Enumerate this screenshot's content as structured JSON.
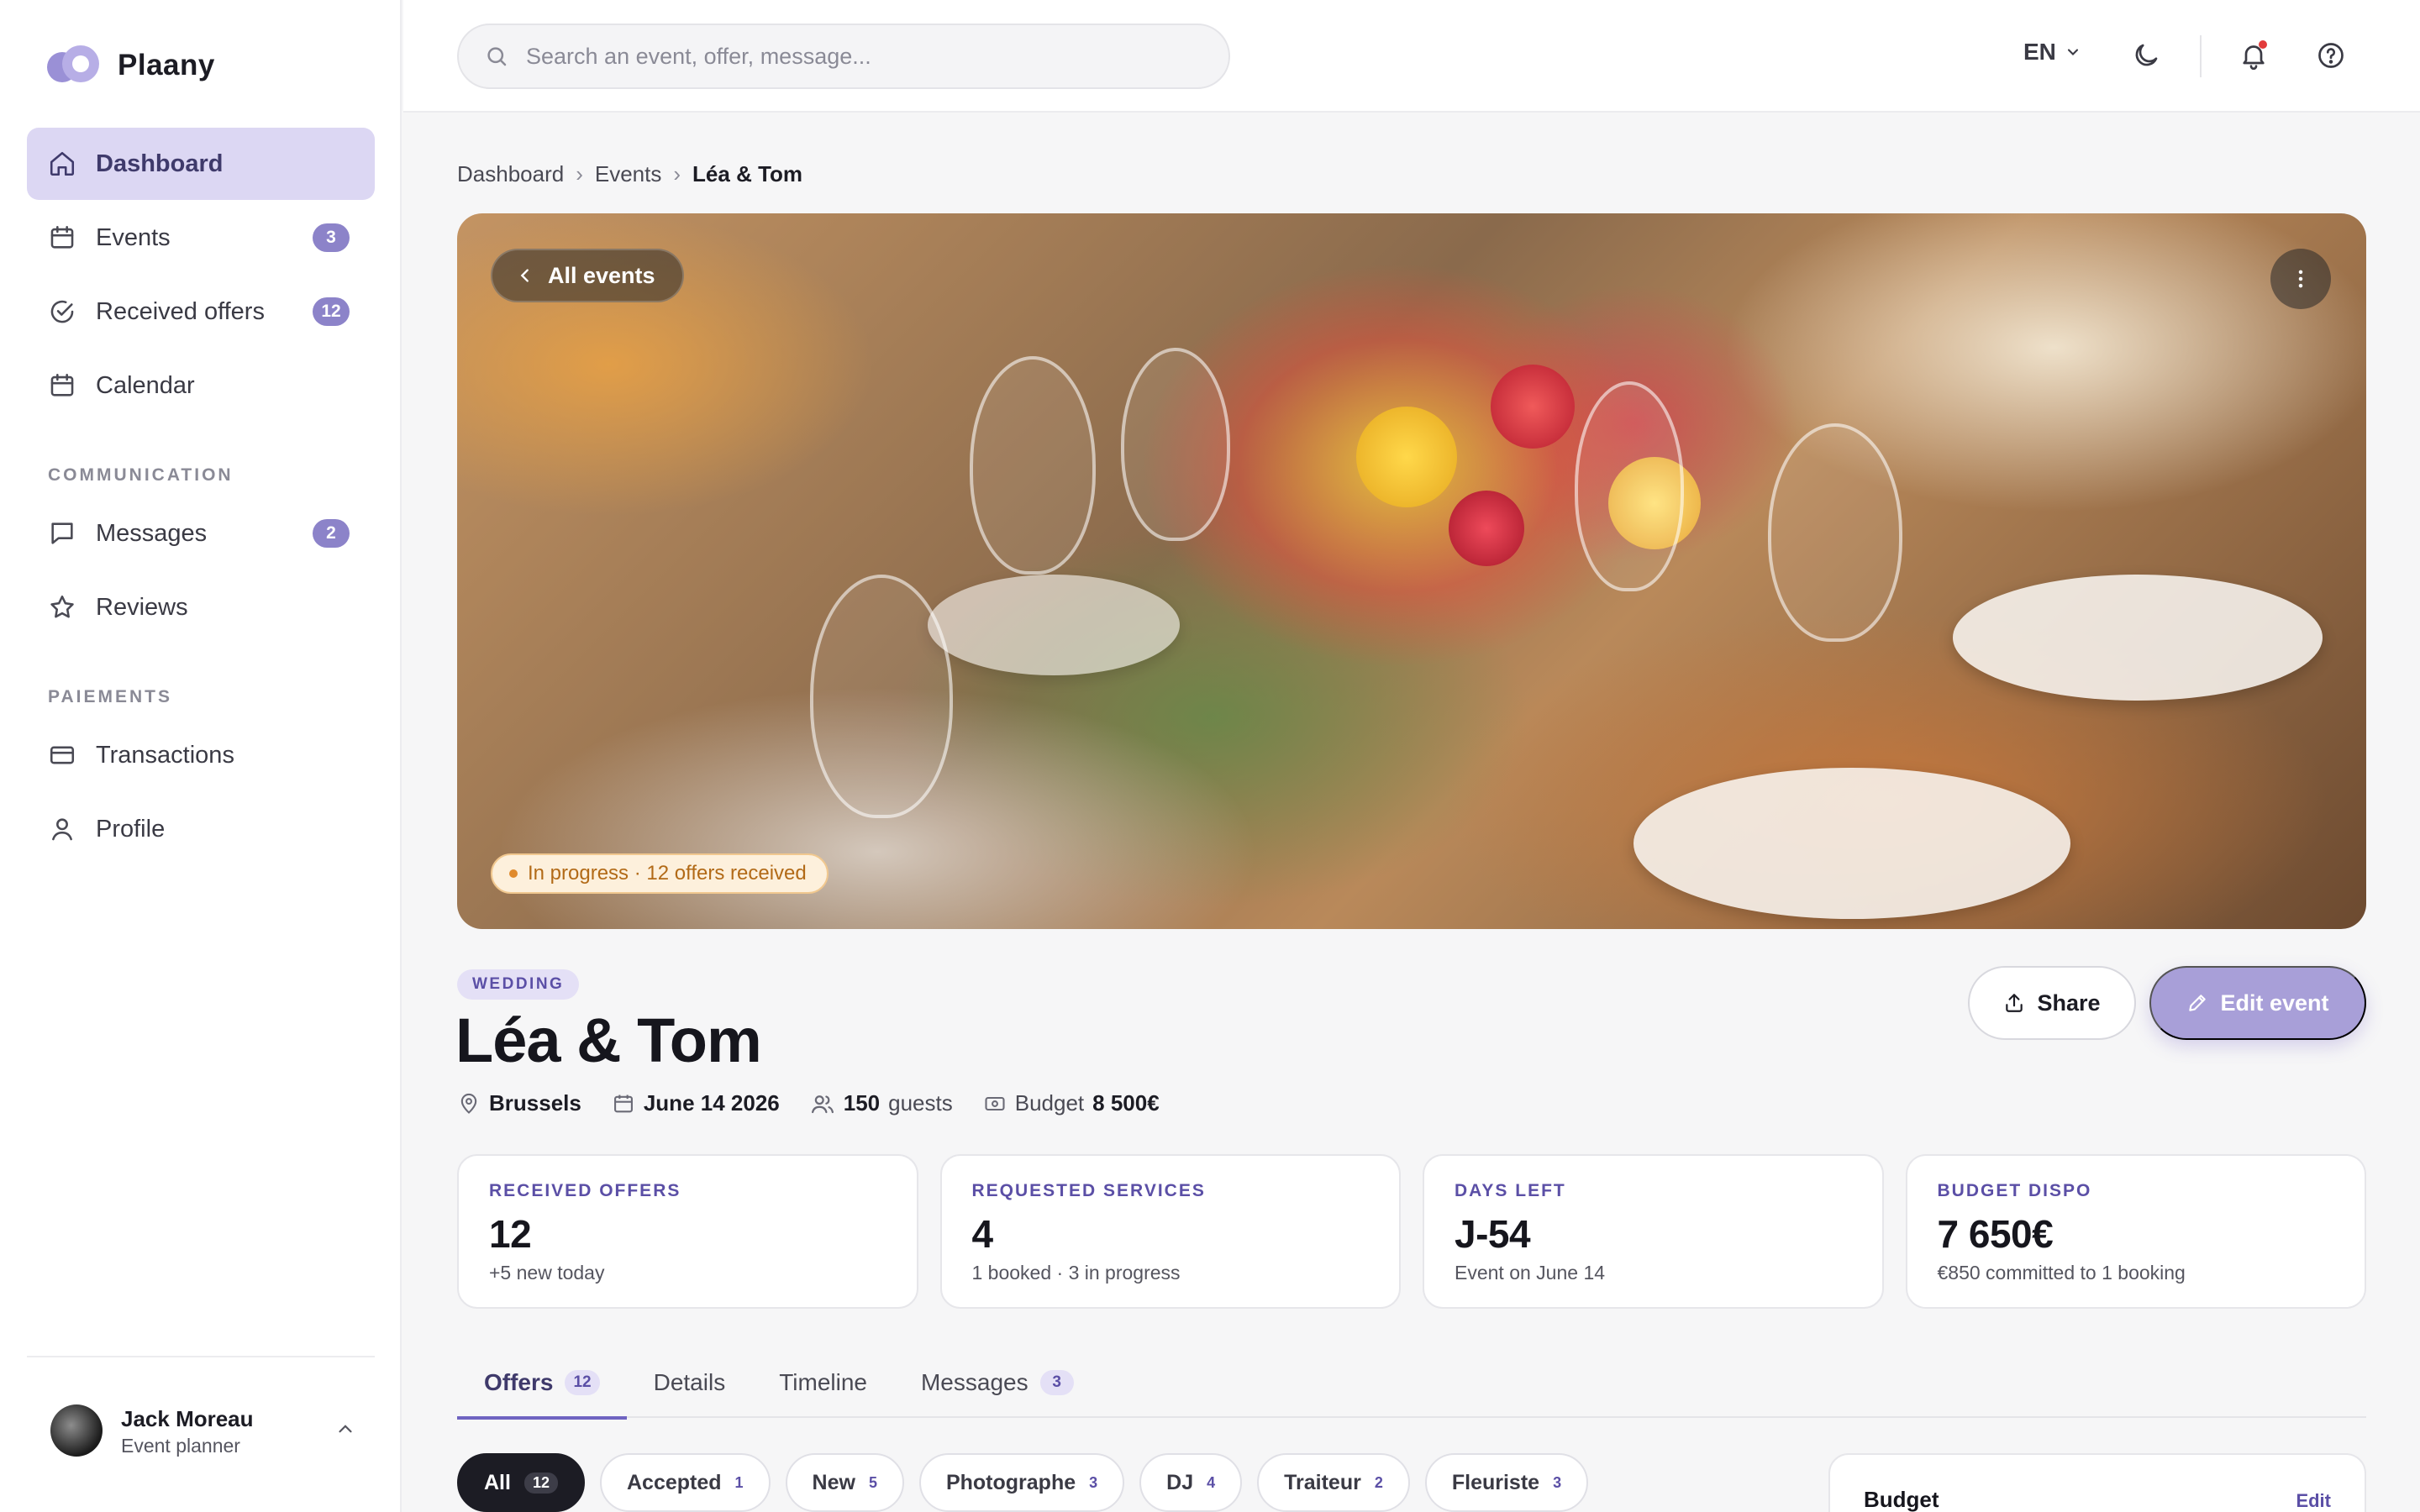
{
  "app": {
    "name": "Plaany"
  },
  "sidebar": {
    "nav": [
      {
        "label": "Dashboard",
        "icon": "home-icon",
        "active": true
      },
      {
        "label": "Events",
        "icon": "calendar-icon",
        "badge": "3"
      },
      {
        "label": "Received offers",
        "icon": "check-circle-icon",
        "badge": "12"
      },
      {
        "label": "Calendar",
        "icon": "calendar-icon"
      }
    ],
    "communication_label": "COMMUNICATION",
    "communication": [
      {
        "label": "Messages",
        "icon": "message-icon",
        "badge": "2"
      },
      {
        "label": "Reviews",
        "icon": "star-icon"
      }
    ],
    "payments_label": "PAIEMENTS",
    "payments": [
      {
        "label": "Transactions",
        "icon": "credit-card-icon"
      },
      {
        "label": "Profile",
        "icon": "user-icon"
      }
    ],
    "user": {
      "name": "Jack Moreau",
      "role": "Event planner"
    }
  },
  "topbar": {
    "search_placeholder": "Search an event, offer, message...",
    "language": "EN"
  },
  "breadcrumb": [
    "Dashboard",
    "Events",
    "Léa & Tom"
  ],
  "hero": {
    "back_label": "All events",
    "status": "In progress · 12 offers received"
  },
  "event": {
    "category": "WEDDING",
    "title": "Léa & Tom",
    "location": "Brussels",
    "date": "June 14 2026",
    "guests_count": "150",
    "guests_label": "guests",
    "budget_label": "Budget",
    "budget_value": "8 500€"
  },
  "actions": {
    "share": "Share",
    "edit": "Edit event"
  },
  "stats": [
    {
      "label": "RECEIVED OFFERS",
      "value": "12",
      "sub": "+5 new today"
    },
    {
      "label": "REQUESTED SERVICES",
      "value": "4",
      "sub": "1 booked · 3 in progress"
    },
    {
      "label": "DAYS LEFT",
      "value": "J-54",
      "sub": "Event on June 14"
    },
    {
      "label": "BUDGET DISPO",
      "value": "7 650€",
      "sub": "€850 committed to 1 booking"
    }
  ],
  "tabs": [
    {
      "label": "Offers",
      "badge": "12",
      "active": true
    },
    {
      "label": "Details"
    },
    {
      "label": "Timeline"
    },
    {
      "label": "Messages",
      "badge": "3"
    }
  ],
  "filters": [
    {
      "label": "All",
      "count": "12",
      "active": true
    },
    {
      "label": "Accepted",
      "count": "1"
    },
    {
      "label": "New",
      "count": "5"
    },
    {
      "label": "Photographe",
      "count": "3"
    },
    {
      "label": "DJ",
      "count": "4"
    },
    {
      "label": "Traiteur",
      "count": "2"
    },
    {
      "label": "Fleuriste",
      "count": "3"
    }
  ],
  "budget_card": {
    "title": "Budget",
    "edit": "Edit"
  },
  "colors": {
    "accent": "#6f63c1",
    "accent_soft": "#dcd7f3",
    "status_orange": "#e08a2c"
  }
}
